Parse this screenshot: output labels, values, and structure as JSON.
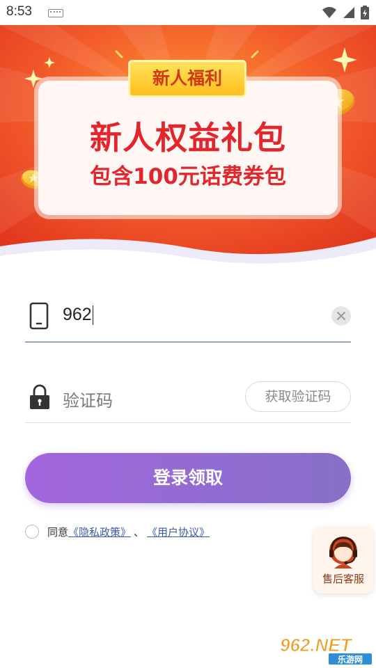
{
  "status_bar": {
    "time": "8:53"
  },
  "banner": {
    "ribbon_label": "新人福利",
    "title": "新人权益礼包",
    "subtitle": "包含100元话费券包"
  },
  "form": {
    "phone_value": "962",
    "code_placeholder": "验证码",
    "get_code_label": "获取验证码",
    "submit_label": "登录领取"
  },
  "agreement": {
    "prefix": "同意",
    "privacy_link": "《隐私政策》",
    "separator": "、",
    "user_link": "《用户协议》"
  },
  "service": {
    "label": "售后客服"
  },
  "watermark": {
    "main": "962.NET",
    "sub": "乐游网"
  },
  "colors": {
    "banner_red": "#e8391c",
    "title_red": "#e2262b",
    "button_purple_start": "#a266dd",
    "button_purple_end": "#8770c8",
    "input_underline": "#3d5a98"
  }
}
